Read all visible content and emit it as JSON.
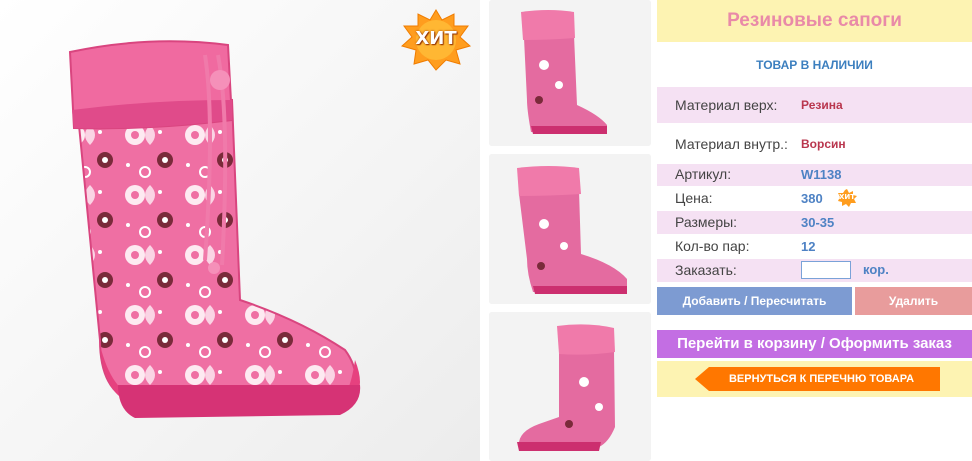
{
  "product": {
    "title": "Резиновые сапоги",
    "stock_status": "ТОВАР В НАЛИЧИИ",
    "badge_text": "ХИТ",
    "mini_badge_text": "ХИТ"
  },
  "details": [
    {
      "label": "Материал верх:",
      "value": "Резина"
    },
    {
      "label": "Материал внутр.:",
      "value": "Ворсин"
    },
    {
      "label": "Артикул:",
      "value": "W1138"
    },
    {
      "label": "Цена:",
      "value": "380"
    },
    {
      "label": "Размеры:",
      "value": "30-35"
    },
    {
      "label": "Кол-во пар:",
      "value": "12"
    },
    {
      "label": "Заказать:",
      "value": ""
    }
  ],
  "order": {
    "quantity_value": "",
    "unit": "кор."
  },
  "buttons": {
    "add": "Добавить / Пересчитать",
    "delete": "Удалить",
    "cart": "Перейти в корзину / Оформить заказ",
    "back": "ВЕРНУТЬСЯ К ПЕРЕЧНЮ ТОВАРА"
  },
  "icons": {
    "hit_badge": "hit-starburst-icon",
    "back_arrow": "arrow-left-icon"
  },
  "colors": {
    "title_bg": "#fdf3b2",
    "title_text": "#e98aa8",
    "highlight_row": "#f5e1f3",
    "add_button": "#7d9bd2",
    "delete_button": "#e89c9c",
    "cart_button": "#c36ee3",
    "back_button": "#ff7700",
    "badge": "#ff9900"
  }
}
